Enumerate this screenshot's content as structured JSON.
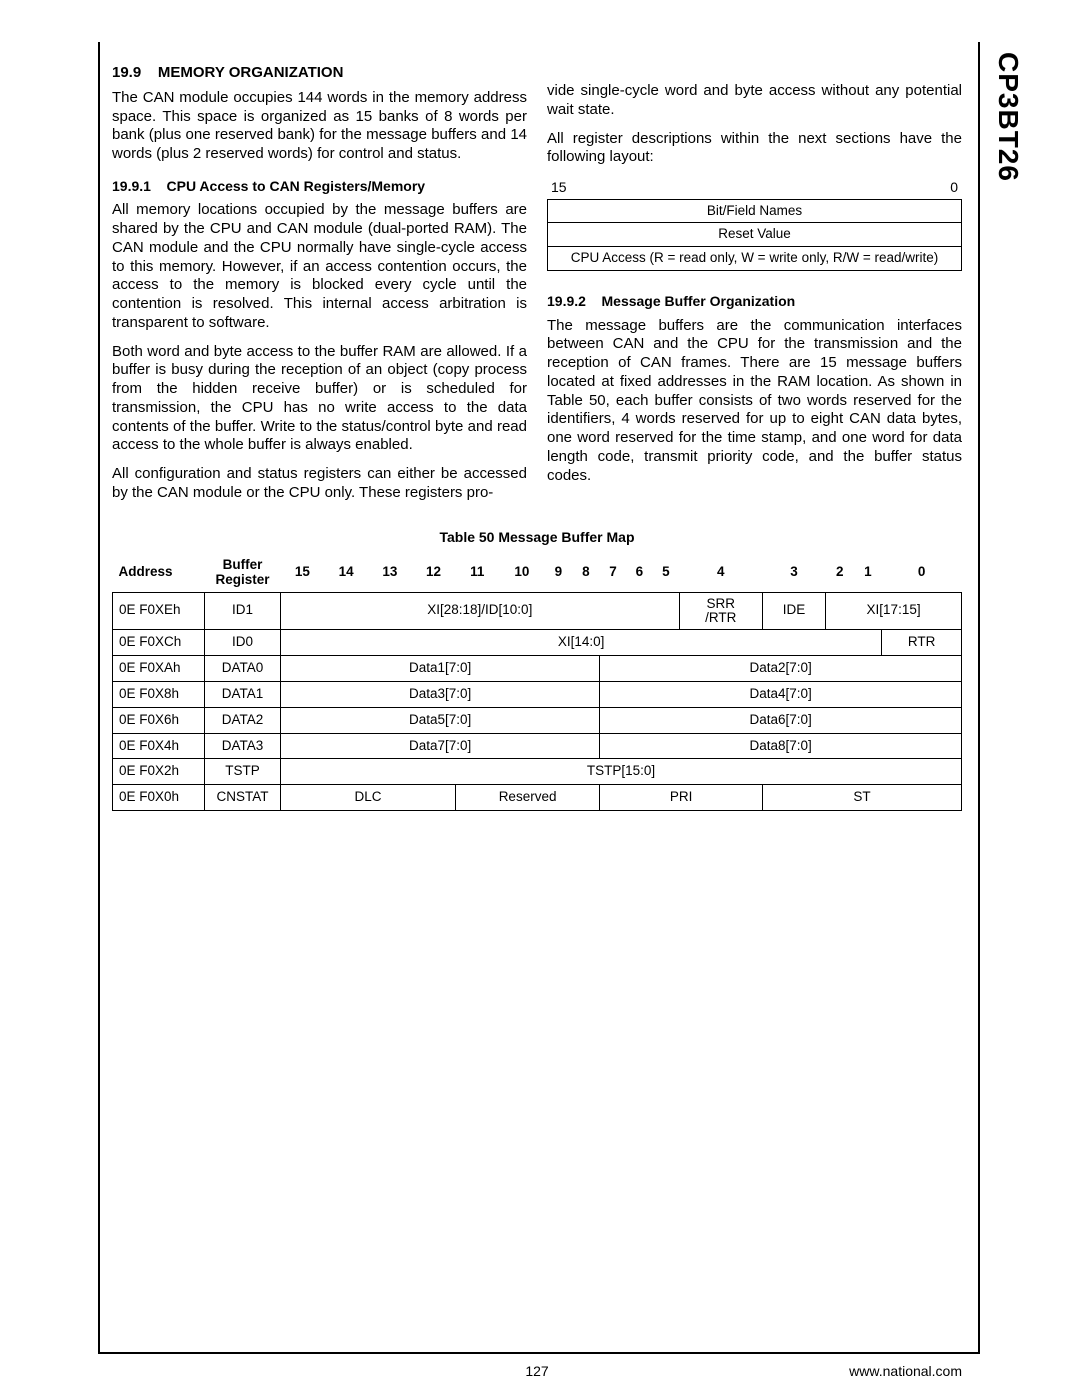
{
  "doc_code": "CP3BT26",
  "page_number": "127",
  "footer_url": "www.national.com",
  "section": {
    "num": "19.9",
    "title": "MEMORY ORGANIZATION",
    "p1": "The CAN module occupies 144 words in the memory address space. This space is organized as 15 banks of 8 words per bank (plus one reserved bank) for the message buffers and 14 words (plus 2 reserved words) for control and status.",
    "sub1_num": "19.9.1",
    "sub1_title": "CPU Access to CAN Registers/Memory",
    "sub1_p1": "All memory locations occupied by the message buffers are shared by the CPU and CAN module (dual-ported RAM). The CAN module and the CPU normally have single-cycle access to this memory. However, if an access contention occurs, the access to the memory is blocked every cycle until the contention is resolved. This internal access arbitration is transparent to software.",
    "sub1_p2": "Both word and byte access to the buffer RAM are allowed. If a buffer is busy during the reception of an object (copy process from the hidden receive buffer) or is scheduled for transmission, the CPU has no write access to the data contents of the buffer. Write to the status/control byte and read access to the whole buffer is always enabled.",
    "sub1_p3a": "All configuration and status registers can either be accessed by the CAN module or the CPU only. These registers pro-",
    "col2_cont": "vide single-cycle word and byte access without any potential wait state.",
    "col2_p2": "All register descriptions within the next sections have the following layout:",
    "bit_hi": "15",
    "bit_lo": "0",
    "reg_rows": {
      "r1": "Bit/Field Names",
      "r2": "Reset Value",
      "r3": "CPU Access (R = read only, W = write only, R/W = read/write)"
    },
    "sub2_num": "19.9.2",
    "sub2_title": "Message Buffer Organization",
    "sub2_p1": "The message buffers are the communication interfaces between CAN and the CPU for the transmission and the reception of CAN frames. There are 15 message buffers located at fixed addresses in the RAM location. As shown in Table 50, each buffer consists of two words reserved for the identifiers, 4 words reserved for up to eight CAN data bytes, one word reserved for the time stamp, and one word for data length code, transmit priority code, and the buffer status codes."
  },
  "table": {
    "caption": "Table 50    Message Buffer Map",
    "head_addr": "Address",
    "head_bufreg_l1": "Buffer",
    "head_bufreg_l2": "Register",
    "bits": [
      "15",
      "14",
      "13",
      "12",
      "11",
      "10",
      "9",
      "8",
      "7",
      "6",
      "5",
      "4",
      "3",
      "2",
      "1",
      "0"
    ],
    "rows": {
      "id1": {
        "addr": "0E F0XEh",
        "reg": "ID1",
        "f1": "XI[28:18]/ID[10:0]",
        "f2a": "SRR",
        "f2b": "/RTR",
        "f3": "IDE",
        "f4": "XI[17:15]"
      },
      "id0": {
        "addr": "0E F0XCh",
        "reg": "ID0",
        "f1": "XI[14:0]",
        "f2": "RTR"
      },
      "d0": {
        "addr": "0E F0XAh",
        "reg": "DATA0",
        "l": "Data1[7:0]",
        "r": "Data2[7:0]"
      },
      "d1": {
        "addr": "0E F0X8h",
        "reg": "DATA1",
        "l": "Data3[7:0]",
        "r": "Data4[7:0]"
      },
      "d2": {
        "addr": "0E F0X6h",
        "reg": "DATA2",
        "l": "Data5[7:0]",
        "r": "Data6[7:0]"
      },
      "d3": {
        "addr": "0E F0X4h",
        "reg": "DATA3",
        "l": "Data7[7:0]",
        "r": "Data8[7:0]"
      },
      "tstp": {
        "addr": "0E F0X2h",
        "reg": "TSTP",
        "f": "TSTP[15:0]"
      },
      "cnstat": {
        "addr": "0E F0X0h",
        "reg": "CNSTAT",
        "f1": "DLC",
        "f2": "Reserved",
        "f3": "PRI",
        "f4": "ST"
      }
    }
  }
}
